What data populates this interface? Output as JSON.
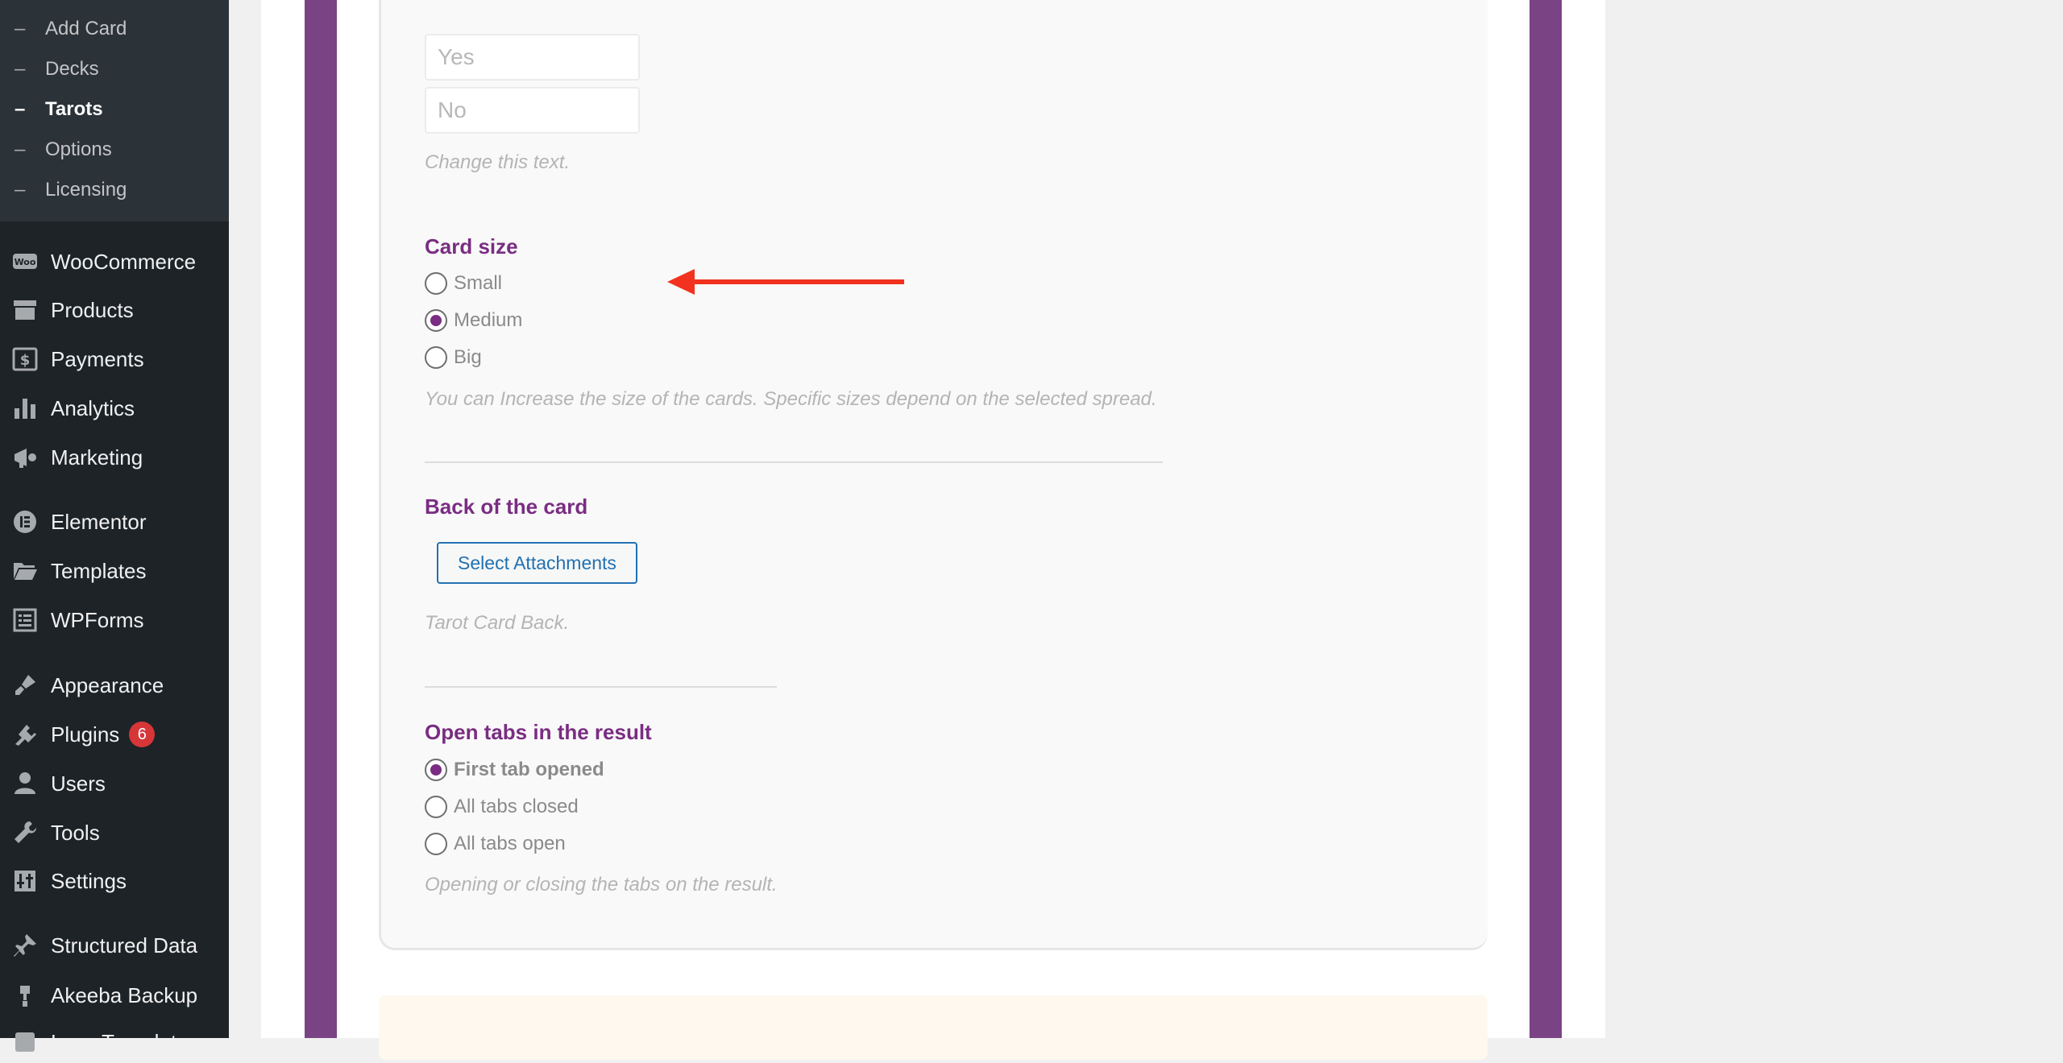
{
  "sidebar": {
    "submenu": [
      {
        "label": "Add Card",
        "current": false
      },
      {
        "label": "Decks",
        "current": false
      },
      {
        "label": "Tarots",
        "current": true
      },
      {
        "label": "Options",
        "current": false
      },
      {
        "label": "Licensing",
        "current": false
      }
    ],
    "menu": [
      {
        "label": "WooCommerce",
        "icon": "woocommerce-icon"
      },
      {
        "label": "Products",
        "icon": "archive-icon"
      },
      {
        "label": "Payments",
        "icon": "dollar-icon"
      },
      {
        "label": "Analytics",
        "icon": "bar-chart-icon"
      },
      {
        "label": "Marketing",
        "icon": "megaphone-icon"
      },
      {
        "label": "Elementor",
        "icon": "elementor-icon"
      },
      {
        "label": "Templates",
        "icon": "folder-icon"
      },
      {
        "label": "WPForms",
        "icon": "form-icon"
      },
      {
        "label": "Appearance",
        "icon": "brush-icon"
      },
      {
        "label": "Plugins",
        "icon": "plugin-icon",
        "badge": "6"
      },
      {
        "label": "Users",
        "icon": "user-icon"
      },
      {
        "label": "Tools",
        "icon": "wrench-icon"
      },
      {
        "label": "Settings",
        "icon": "settings-icon"
      },
      {
        "label": "Structured Data",
        "icon": "pin-icon"
      },
      {
        "label": "Akeeba Backup",
        "icon": "backup-icon"
      },
      {
        "label": "Loco Translate",
        "icon": "translate-icon"
      }
    ]
  },
  "form": {
    "yes_placeholder": "Yes",
    "no_placeholder": "No",
    "change_text_help": "Change this text.",
    "card_size": {
      "title": "Card size",
      "options": [
        "Small",
        "Medium",
        "Big"
      ],
      "selected": "Medium",
      "help": "You can Increase the size of the cards. Specific sizes depend on the selected spread."
    },
    "card_back": {
      "title": "Back of the card",
      "button_label": "Select Attachments",
      "help": "Tarot Card Back."
    },
    "open_tabs": {
      "title": "Open tabs in the result",
      "options": [
        "First tab opened",
        "All tabs closed",
        "All tabs open"
      ],
      "selected": "First tab opened",
      "help": "Opening or closing the tabs on the result."
    }
  },
  "colors": {
    "accent_purple": "#7a2d82",
    "frame_purple": "#7a4484",
    "annotation_arrow": "#f2321e",
    "sidebar_bg": "#1d2327",
    "badge_red": "#d63638"
  }
}
